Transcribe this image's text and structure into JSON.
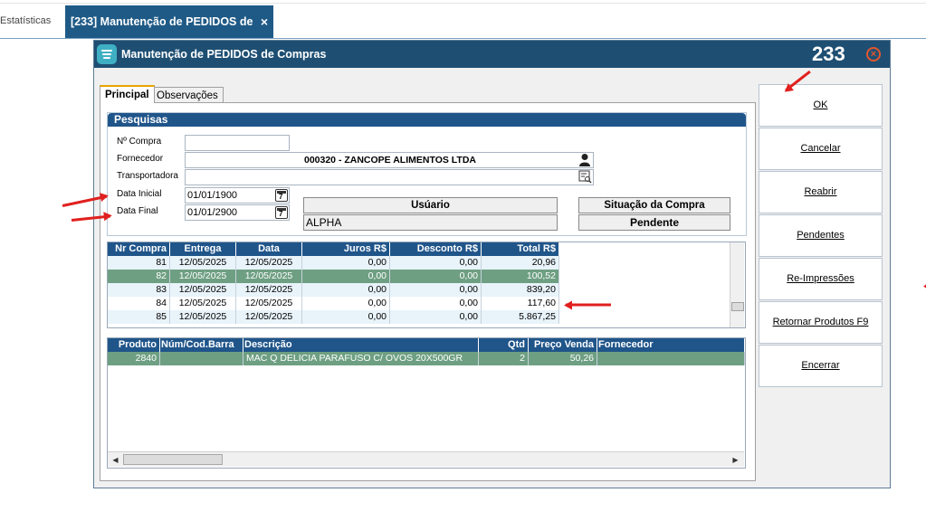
{
  "app_tabs": {
    "inactive_label": "Estatísticas",
    "active_label": "[233] Manutenção de PEDIDOS de",
    "close_glyph": "×"
  },
  "window": {
    "title": "Manutenção de PEDIDOS de Compras",
    "number": "233",
    "close_glyph": "×"
  },
  "tabs": [
    {
      "label": "Principal",
      "active": true
    },
    {
      "label": "Observações",
      "active": false
    }
  ],
  "pesquisas": {
    "title": "Pesquisas",
    "nr_compra": {
      "label": "Nº Compra",
      "value": ""
    },
    "fornecedor": {
      "label": "Fornecedor",
      "value": "000320 - ZANCOPE ALIMENTOS LTDA",
      "icon": "person-icon"
    },
    "transportadora": {
      "label": "Transportadora",
      "value": "",
      "icon": "search-list-icon"
    },
    "data_inicial": {
      "label": "Data Inicial",
      "value": "01/01/1900",
      "icon": "calendar-icon"
    },
    "data_final": {
      "label": "Data Final",
      "value": "01/01/2900",
      "icon": "calendar-icon"
    },
    "usuario": {
      "label": "Usúario",
      "value": "ALPHA"
    },
    "situacao": {
      "label": "Situação da Compra",
      "value": "Pendente"
    }
  },
  "orders_table": {
    "headers": [
      "Nr Compra",
      "Entrega",
      "Data",
      "Juros R$",
      "Desconto R$",
      "Total R$"
    ],
    "rows": [
      [
        "81",
        "12/05/2025",
        "12/05/2025",
        "0,00",
        "0,00",
        "20,96"
      ],
      [
        "82",
        "12/05/2025",
        "12/05/2025",
        "0,00",
        "0,00",
        "100,52"
      ],
      [
        "83",
        "12/05/2025",
        "12/05/2025",
        "0,00",
        "0,00",
        "839,20"
      ],
      [
        "84",
        "12/05/2025",
        "12/05/2025",
        "0,00",
        "0,00",
        "117,60"
      ],
      [
        "85",
        "12/05/2025",
        "12/05/2025",
        "0,00",
        "0,00",
        "5.867,25"
      ]
    ],
    "selected_row": 1
  },
  "items_table": {
    "headers": [
      "Produto",
      "Núm/Cod.Barra",
      "Descrição",
      "Qtd",
      "Preço Venda",
      "Fornecedor"
    ],
    "rows": [
      [
        "2840",
        "",
        "MAC Q DELICIA PARAFUSO C/ OVOS 20X500GR",
        "2",
        "50,26",
        ""
      ]
    ],
    "selected_row": 0
  },
  "buttons": [
    {
      "label": "OK"
    },
    {
      "label": "Cancelar"
    },
    {
      "label": "Reabrir"
    },
    {
      "label": "Pendentes"
    },
    {
      "label": "Re-Impressões"
    },
    {
      "label": "Retornar Produtos F9"
    },
    {
      "label": "Encerrar"
    }
  ],
  "colors": {
    "titlebar": "#1e4f73",
    "grid_header": "#20558a",
    "selected_row": "#6e9f82",
    "annotation_arrow": "#e0201e"
  }
}
